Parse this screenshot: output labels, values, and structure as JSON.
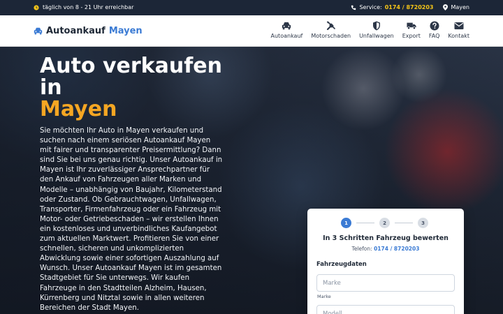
{
  "topbar": {
    "hours": "täglich von 8 - 21 Uhr erreichbar",
    "service_label": "Service:",
    "service_phone": "0174 / 8720203",
    "location": "Mayen"
  },
  "brand": {
    "name": "Autoankauf",
    "city": "Mayen"
  },
  "nav": [
    {
      "label": "Autoankauf",
      "icon": "car-icon"
    },
    {
      "label": "Motorschaden",
      "icon": "tools-icon"
    },
    {
      "label": "Unfallwagen",
      "icon": "shield-icon"
    },
    {
      "label": "Export",
      "icon": "truck-icon"
    },
    {
      "label": "FAQ",
      "icon": "question-icon"
    },
    {
      "label": "Kontakt",
      "icon": "envelope-icon"
    }
  ],
  "hero": {
    "title_line1": "Auto verkaufen in",
    "title_city": "Mayen",
    "intro": "Sie möchten Ihr Auto in Mayen verkaufen und suchen nach einem seriösen Autoankauf Mayen mit fairer und transparenter Preisermittlung? Dann sind Sie bei uns genau richtig. Unser Autoankauf in Mayen ist Ihr zuverlässiger Ansprechpartner für den Ankauf von Fahrzeugen aller Marken und Modelle – unabhängig von Baujahr, Kilometerstand oder Zustand. Ob Gebrauchtwagen, Unfallwagen, Transporter, Firmenfahrzeug oder ein Fahrzeug mit Motor- oder Getriebeschaden – wir erstellen Ihnen ein kostenloses und unverbindliches Kaufangebot zum aktuellen Marktwert. Profitieren Sie von einer schnellen, sicheren und unkomplizierten Abwicklung sowie einer sofortigen Auszahlung auf Wunsch. Unser Autoankauf Mayen ist im gesamten Stadtgebiet für Sie unterwegs. Wir kaufen Fahrzeuge in den Stadtteilen Alzheim, Hausen, Kürrenberg und Nitztal sowie in allen weiteren Bereichen der Stadt Mayen."
  },
  "form": {
    "steps": [
      "1",
      "2",
      "3"
    ],
    "active_step": 1,
    "title": "In 3 Schritten Fahrzeug bewerten",
    "phone_label": "Telefon:",
    "phone": "0174 / 8720203",
    "section": "Fahrzeugdaten",
    "make_placeholder": "Marke",
    "make_label": "Marke",
    "model_placeholder": "Modell"
  },
  "colors": {
    "accent": "#3b7bd4",
    "highlight": "#f5a623",
    "phone": "#f5c518",
    "topbar": "#1c2637"
  }
}
